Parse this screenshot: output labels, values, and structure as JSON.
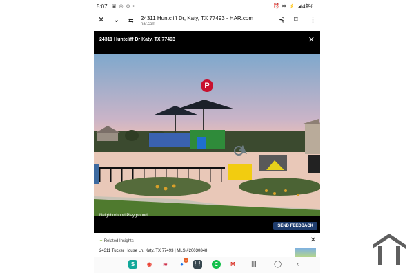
{
  "status_bar": {
    "time": "5:07",
    "battery": "49%"
  },
  "browser": {
    "title": "24311 Huntcliff Dr, Katy, TX 77493 - HAR.com",
    "domain": "har.com"
  },
  "gallery": {
    "header_title": "24311 Huntcliff Dr Katy, TX 77493",
    "pinterest_label": "P",
    "caption": "Neighborhood Playground",
    "feedback_label": "SEND FEEDBACK"
  },
  "insights": {
    "label": "Related Insights",
    "listing": "24311 Tucker House Ln, Katy, TX 77493 | MLS #20030848"
  },
  "nav": {
    "apps": [
      {
        "name": "samsung-wallet-icon",
        "glyph": "S",
        "color": "#12a89a"
      },
      {
        "name": "google-maps-icon",
        "glyph": "◉",
        "color": "#ea4335"
      },
      {
        "name": "bank-of-america-icon",
        "glyph": "≋",
        "color": "#c8102e"
      },
      {
        "name": "messages-icon",
        "glyph": "●",
        "color": "#1a73e8"
      },
      {
        "name": "app-drawer-icon",
        "glyph": "⋮⋮",
        "color": "#37474f"
      },
      {
        "name": "cash-app-icon",
        "glyph": "C",
        "color": "#14c04c"
      },
      {
        "name": "gmail-icon",
        "glyph": "M",
        "color": "#d93025"
      }
    ],
    "messages_badge": "1"
  }
}
